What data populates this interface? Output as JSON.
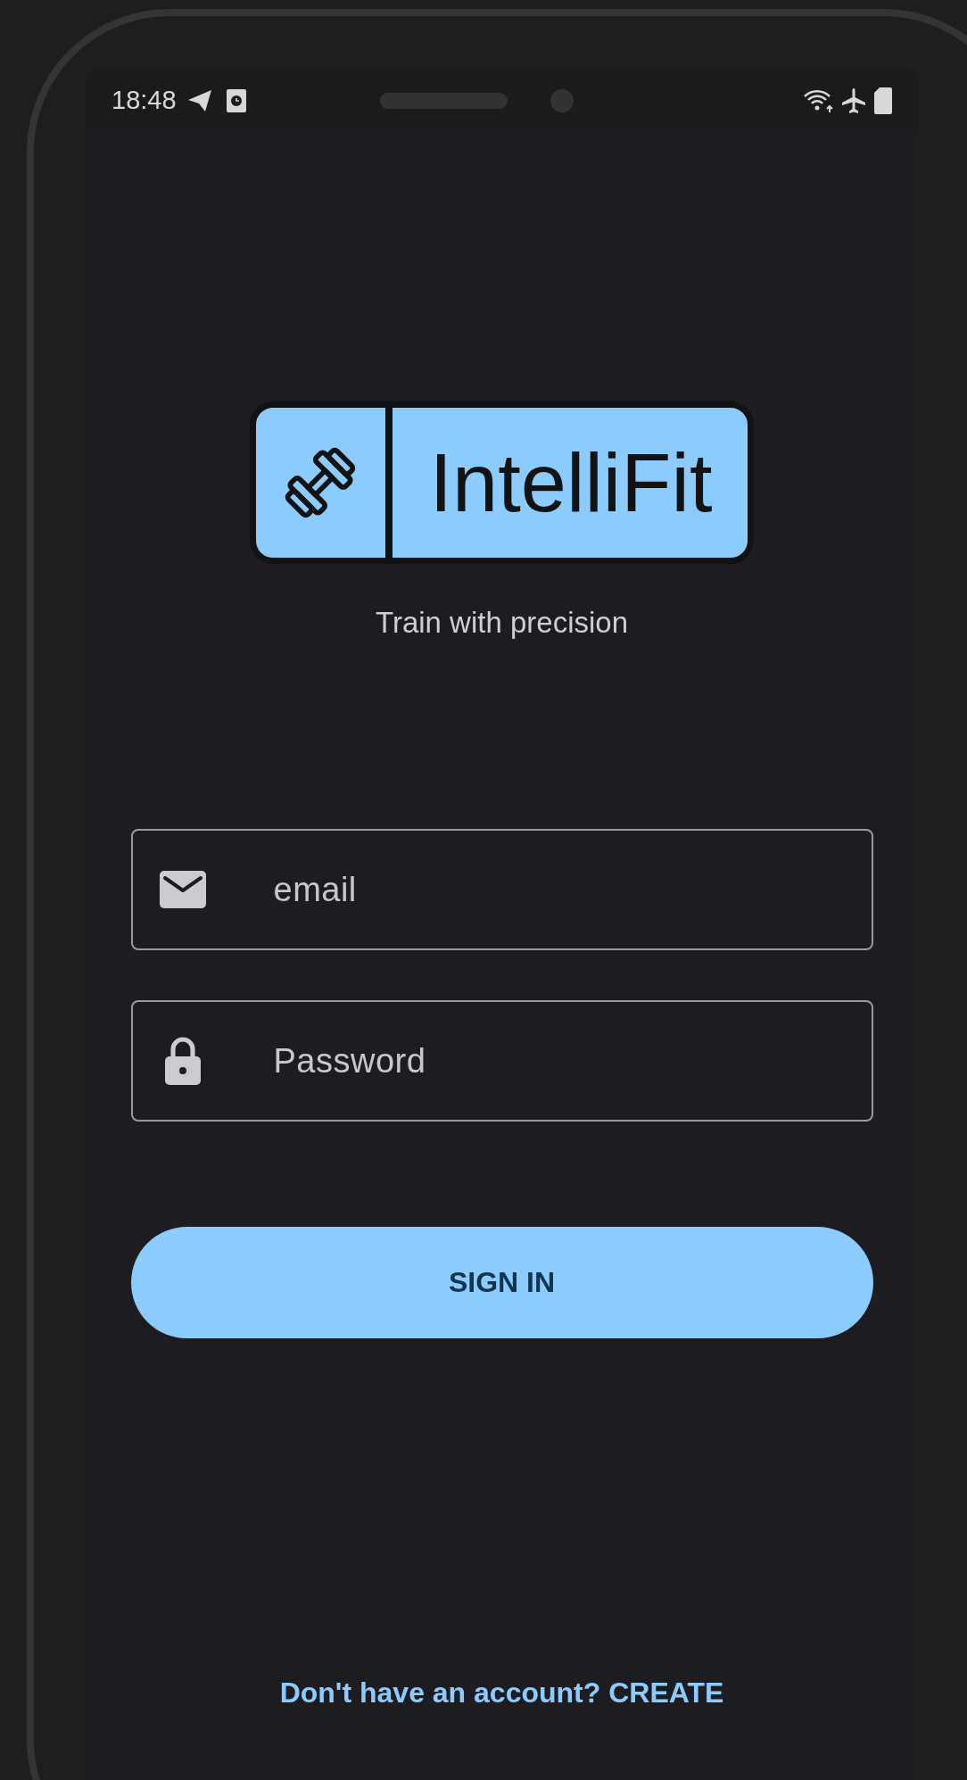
{
  "status_bar": {
    "time": "18:48"
  },
  "logo": {
    "name": "IntelliFit"
  },
  "tagline": "Train with precision",
  "fields": [
    {
      "kind": "email",
      "placeholder": "email"
    },
    {
      "kind": "password",
      "placeholder": "Password"
    }
  ],
  "sign_in_button": "SIGN IN",
  "create_account_link": "Don't have an account? CREATE"
}
